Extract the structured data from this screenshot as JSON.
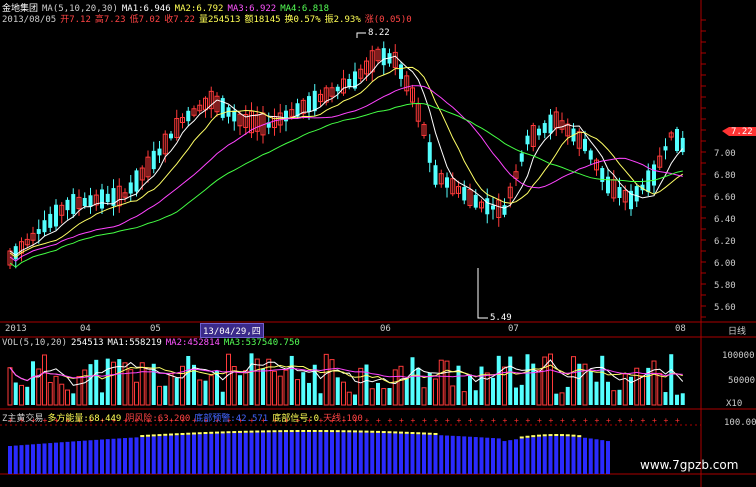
{
  "header": {
    "stock_name": "金地集团",
    "ma_prefix": "MA(5,10,20,30)",
    "ma1": "MA1:6.946",
    "ma2": "MA2:6.792",
    "ma3": "MA3:6.922",
    "ma4": "MA4:6.818",
    "date": "2013/08/05",
    "open": "开7.12",
    "high": "高7.23",
    "low": "低7.02",
    "close": "收7.22",
    "volume": "量254513",
    "amount": "额18145",
    "turnover": "换0.57%",
    "amplitude": "振2.93%",
    "change": "涨(0.05)0"
  },
  "price_axis": {
    "labels": [
      "7.00",
      "6.80",
      "6.60",
      "6.40",
      "6.20",
      "6.00",
      "5.80",
      "5.60"
    ],
    "current": "7.22"
  },
  "annotations": {
    "high_mark": "8.22",
    "low_mark": "5.49"
  },
  "date_axis": {
    "labels": [
      "2013",
      "04",
      "05",
      "06",
      "07",
      "08"
    ],
    "selected": "13/04/29,四",
    "period_label": "日线"
  },
  "volume_panel": {
    "title": "VOL(5,10,20)",
    "value": "254513",
    "ma1": "MA1:558219",
    "ma2": "MA2:452814",
    "ma3": "MA3:537540.750",
    "axis_labels": [
      "100000",
      "50000",
      "X10"
    ]
  },
  "indicator_panel": {
    "title": "Z主黄交易",
    "energy": "多方能量:68.449",
    "risk": "阴风险:63.200",
    "warning": "底部预警:42.571",
    "bottom_signal": "底部信号:0",
    "sky_line": "天线:100",
    "axis_label": "100.00"
  },
  "watermark": "www.7gpzb.com",
  "colors": {
    "up": "#ff3a3a",
    "down": "#54ffff",
    "ma_white": "#ffffff",
    "ma_yellow": "#ffff66",
    "ma_magenta": "#ff44ff",
    "ma_green": "#44ff44",
    "grid": "#aa0000"
  }
}
